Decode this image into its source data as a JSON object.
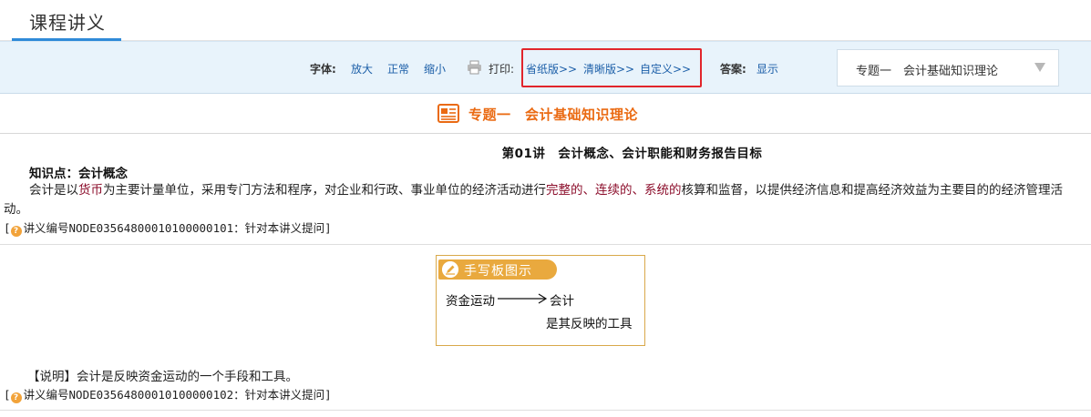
{
  "tab": {
    "title": "课程讲义"
  },
  "toolbar": {
    "font_label": "字体:",
    "font_options": [
      "放大",
      "正常",
      "缩小"
    ],
    "print_label": "打印:",
    "print_options": [
      "省纸版>>",
      "清晰版>>",
      "自定义>>"
    ],
    "answer_label": "答案:",
    "answer_link": "显示",
    "topic_select": "专题一　会计基础知识理论",
    "highlight_color": "#e1252b"
  },
  "section": {
    "title": "专题一　会计基础知识理论",
    "icon": "document-icon"
  },
  "lecture": {
    "title": "第01讲　会计概念、会计职能和财务报告目标",
    "knowledge_point": "知识点：会计概念",
    "para_parts": [
      "会计是以",
      "货币",
      "为主要计量单位，采用专门方法和程序，对企业和行政、事业单位的经济活动进行",
      "完整的、连续的、系统的",
      "核算和监督，以提供经济信息和提高经济效益为主要目的的经济管理活动。"
    ],
    "ref1": "讲义编号NODE03564800010100000101：针对本讲义提问"
  },
  "handwriting": {
    "title": "手写板图示",
    "line1_left": "资金运动",
    "line1_right": "会计",
    "line2": "是其反映的工具"
  },
  "note": "【说明】会计是反映资金运动的一个手段和工具。",
  "ref2": "讲义编号NODE03564800010100000102：针对本讲义提问",
  "colors": {
    "accent_blue": "#2f8ad8",
    "section_orange": "#ea6a12",
    "highlight_red": "#8b0c2a",
    "handwriting_gold": "#e9a93e"
  }
}
